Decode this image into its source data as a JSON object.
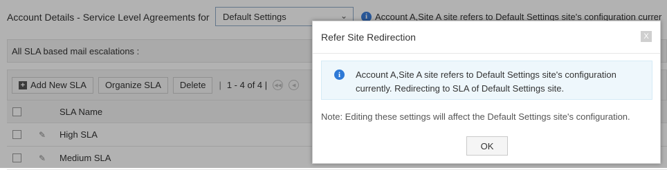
{
  "header": {
    "title": "Account Details - Service Level Agreements for",
    "site_select_value": "Default Settings",
    "info_prefix": "Account A,Site A site refers to Default Settings site's configuration currer"
  },
  "escalations": {
    "label": "All SLA based mail escalations :"
  },
  "toolbar": {
    "add_label": "Add New SLA",
    "organize_label": "Organize SLA",
    "delete_label": "Delete",
    "separator": "|",
    "pager_text": "1 - 4 of 4 |"
  },
  "table": {
    "column_header": "SLA Name",
    "rows": [
      {
        "name": "High SLA"
      },
      {
        "name": "Medium SLA"
      }
    ]
  },
  "dialog": {
    "title": "Refer Site Redirection",
    "close_label": "X",
    "message_line1": "Account A,Site A site refers to Default Settings site's configuration",
    "message_line2": "currently. Redirecting to SLA of Default Settings site.",
    "note": "Note: Editing these settings will affect the Default Settings site's configuration.",
    "ok_label": "OK"
  },
  "icons": {
    "info": "info-icon",
    "plus": "plus-icon",
    "edit": "edit-icon",
    "first_page": "first-page-icon",
    "prev_page": "prev-page-icon",
    "close": "close-icon"
  },
  "colors": {
    "info_blue": "#2e79d6",
    "select_border": "#8fa9c8",
    "message_bg": "#eef7fc",
    "overlay": "rgba(0,0,0,0.30)"
  }
}
